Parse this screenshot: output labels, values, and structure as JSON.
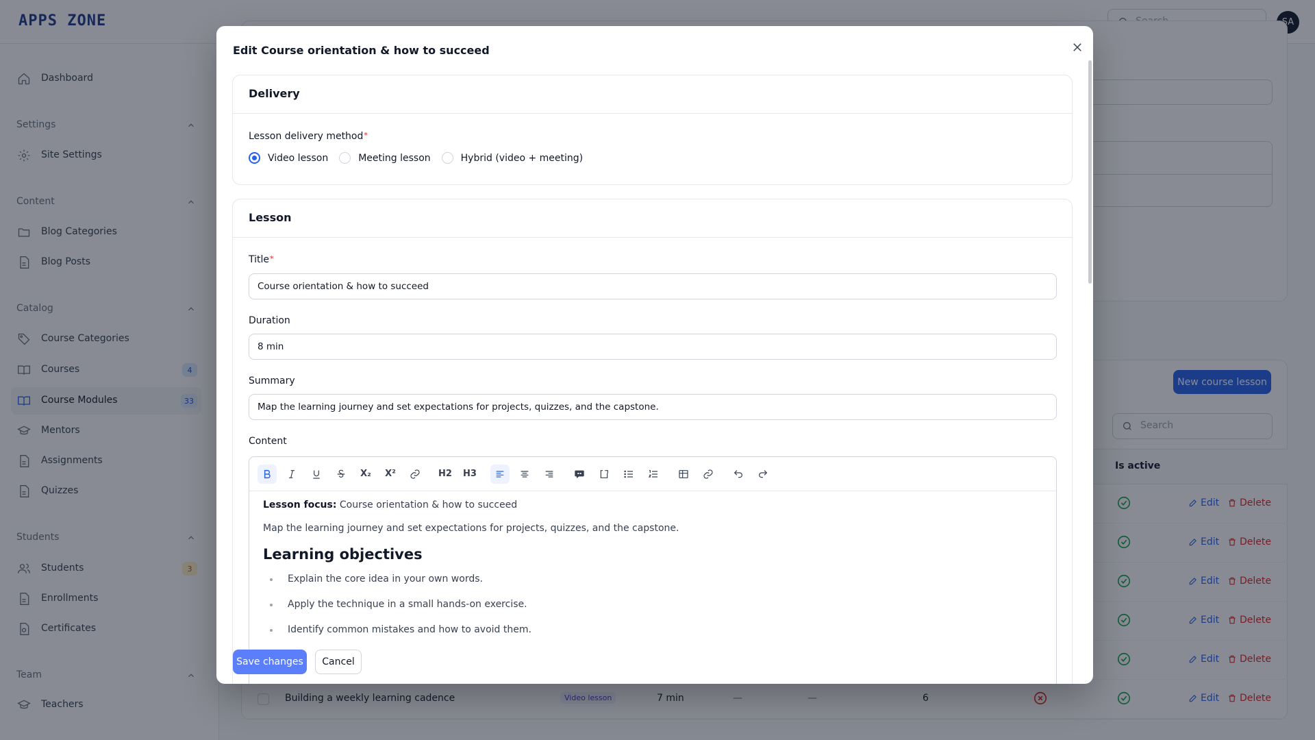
{
  "app": {
    "logo": "APPS ZONE",
    "search_placeholder": "Search",
    "avatar_initials": "SA"
  },
  "sidebar": {
    "dashboard": "Dashboard",
    "groups": {
      "settings": "Settings",
      "content": "Content",
      "catalog": "Catalog",
      "students": "Students",
      "team": "Team"
    },
    "items": {
      "site_settings": "Site Settings",
      "blog_categories": "Blog Categories",
      "blog_posts": "Blog Posts",
      "course_categories": "Course Categories",
      "courses": "Courses",
      "courses_badge": "4",
      "course_modules": "Course Modules",
      "course_modules_badge": "33",
      "mentors": "Mentors",
      "assignments": "Assignments",
      "quizzes": "Quizzes",
      "students": "Students",
      "students_badge": "3",
      "enrollments": "Enrollments",
      "certificates": "Certificates",
      "teachers": "Teachers"
    }
  },
  "background": {
    "new_lesson_button": "New course lesson",
    "table_search_placeholder": "Search",
    "col_is_active": "Is active",
    "row_edit": "Edit",
    "row_delete": "Delete",
    "last_row": {
      "title": "Building a weekly learning cadence",
      "type": "Video lesson",
      "duration": "7 min",
      "dash1": "—",
      "dash2": "—",
      "position": "6"
    }
  },
  "modal": {
    "title": "Edit Course orientation & how to succeed",
    "delivery": {
      "heading": "Delivery",
      "method_label": "Lesson delivery method",
      "required_mark": "*",
      "options": [
        "Video lesson",
        "Meeting lesson",
        "Hybrid (video + meeting)"
      ],
      "selected": "Video lesson"
    },
    "lesson": {
      "heading": "Lesson",
      "title_label": "Title",
      "title_value": "Course orientation & how to succeed",
      "duration_label": "Duration",
      "duration_value": "8 min",
      "summary_label": "Summary",
      "summary_value": "Map the learning journey and set expectations for projects, quizzes, and the capstone.",
      "content_label": "Content",
      "toolbar": {
        "h2": "H2",
        "h3": "H3",
        "subscript": "X₂",
        "superscript": "X²"
      },
      "content": {
        "focus_label": "Lesson focus:",
        "focus_value": "Course orientation & how to succeed",
        "intro": "Map the learning journey and set expectations for projects, quizzes, and the capstone.",
        "objectives_heading": "Learning objectives",
        "objectives": [
          "Explain the core idea in your own words.",
          "Apply the technique in a small hands-on exercise.",
          "Identify common mistakes and how to avoid them."
        ]
      }
    },
    "save_button": "Save changes",
    "cancel_button": "Cancel"
  },
  "colors": {
    "primary": "#2563eb",
    "save_button": "#5b7ffa",
    "danger": "#dc2626",
    "success": "#16a34a"
  },
  "icons": [
    "search-icon",
    "home-icon",
    "gear-icon",
    "folder-icon",
    "document-icon",
    "tag-icon",
    "book-icon",
    "user-icon",
    "users-icon",
    "certificate-icon",
    "academic-cap-icon",
    "chevron-up-icon",
    "close-icon",
    "edit-icon",
    "trash-icon",
    "check-circle-icon",
    "x-circle-icon"
  ]
}
